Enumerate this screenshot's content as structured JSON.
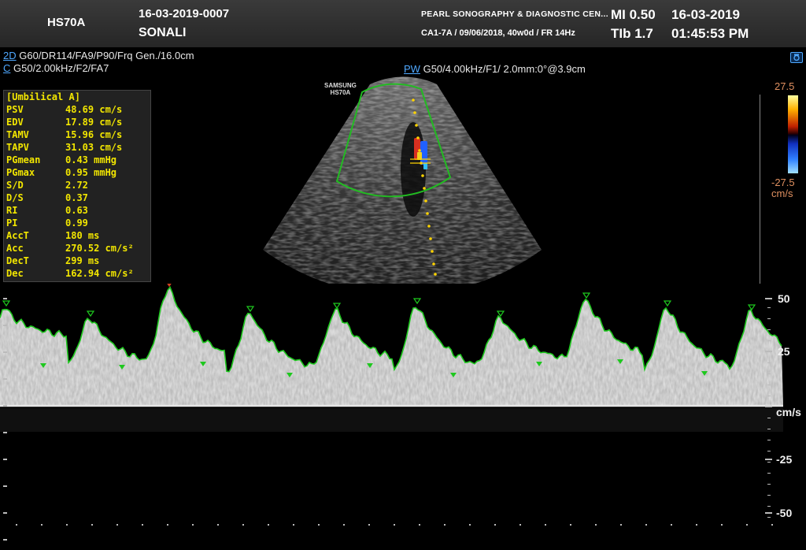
{
  "header": {
    "model": "HS70A",
    "patient_id": "16-03-2019-0007",
    "patient_name": "SONALI",
    "institution": "PEARL SONOGRAPHY & DIAGNOSTIC CEN...",
    "exam_info": "CA1-7A / 09/06/2018, 40w0d / FR 14Hz",
    "mi": "MI  0.50",
    "tib": "TIb 1.7",
    "date": "16-03-2019",
    "time": "01:45:53 PM"
  },
  "params": {
    "mode_2d": "2D",
    "params_2d": "G60/DR114/FA9/P90/Frq Gen./16.0cm",
    "mode_c": "C",
    "params_c": "G50/2.00kHz/F2/FA7",
    "mode_pw": "PW",
    "params_pw": "G50/4.00kHz/F1/ 2.0mm:0°@3.9cm"
  },
  "measurements": {
    "title": "[Umbilical A]",
    "rows": [
      {
        "label": "PSV",
        "value": "48.69 cm/s"
      },
      {
        "label": "EDV",
        "value": "17.89 cm/s"
      },
      {
        "label": "TAMV",
        "value": "15.96 cm/s"
      },
      {
        "label": "TAPV",
        "value": "31.03 cm/s"
      },
      {
        "label": "PGmean",
        "value": "0.43 mmHg"
      },
      {
        "label": "PGmax",
        "value": "0.95 mmHg"
      },
      {
        "label": "S/D",
        "value": "2.72"
      },
      {
        "label": "D/S",
        "value": "0.37"
      },
      {
        "label": "RI",
        "value": "0.63"
      },
      {
        "label": "PI",
        "value": "0.99"
      },
      {
        "label": "AccT",
        "value": "180    ms"
      },
      {
        "label": "Acc",
        "value": "270.52 cm/s²"
      },
      {
        "label": "DecT",
        "value": "299    ms"
      },
      {
        "label": "Dec",
        "value": "162.94 cm/s²"
      }
    ]
  },
  "colorbar": {
    "top": "27.5",
    "bottom": "-27.5",
    "unit": "cm/s"
  },
  "spectral_scale": {
    "v50": "50",
    "v25": "25",
    "unit": "cm/s",
    "vm25": "-25",
    "vm50": "-50"
  },
  "probe_label": {
    "line1": "SAMSUNG",
    "line2": "HS70A"
  },
  "icons": {
    "settings": "screen-capture-icon"
  },
  "colors": {
    "measure_text": "#f2e600",
    "trace": "#1ec81e",
    "mode_link": "#4fa8ff",
    "colorbar_label": "#e09060"
  }
}
